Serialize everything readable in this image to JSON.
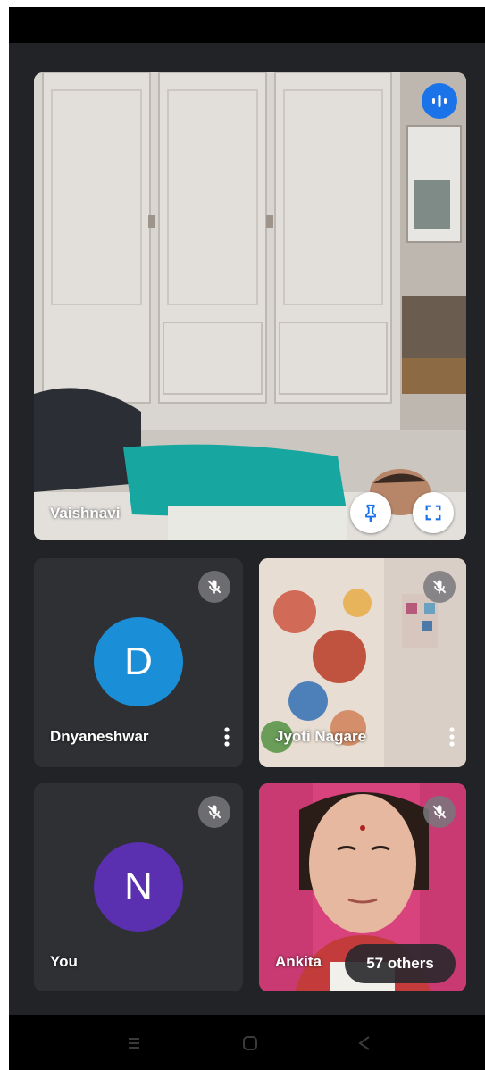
{
  "participants": {
    "main": {
      "name": "Vaishnavi"
    },
    "tile1": {
      "name": "Dnyaneshwar",
      "initial": "D",
      "avatar_color": "#1a8fd8"
    },
    "tile2": {
      "name": "Jyoti Nagare"
    },
    "tile3": {
      "name": "You",
      "initial": "N",
      "avatar_color": "#5a2fb0"
    },
    "tile4": {
      "name": "Ankita",
      "others_label": "57 others"
    }
  },
  "icons": {
    "speaking": "audio-wave-icon",
    "pin": "pin-icon",
    "fullscreen": "fullscreen-icon",
    "muted": "mic-off-icon",
    "more": "more-vertical-icon",
    "nav_recents": "recents-icon",
    "nav_home": "home-icon",
    "nav_back": "back-icon"
  },
  "colors": {
    "background": "#222326",
    "accent_blue": "#1a73e8"
  }
}
